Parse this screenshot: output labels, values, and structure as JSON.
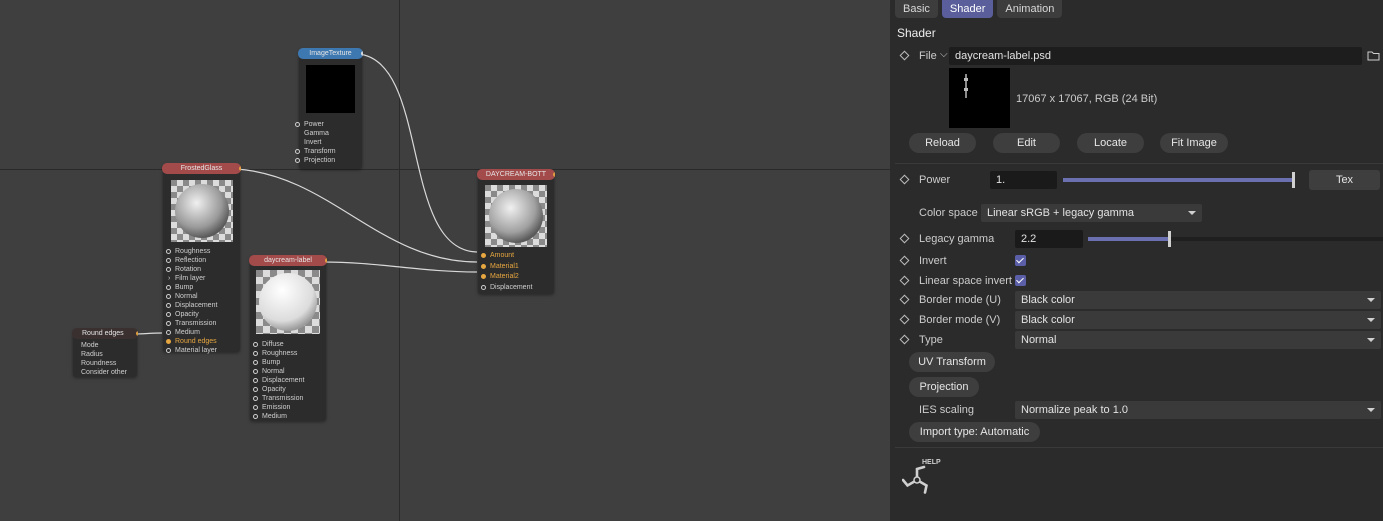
{
  "graph": {
    "nodes": {
      "image_texture": {
        "title": "ImageTexture",
        "pins": [
          "Power",
          "Gamma",
          "Invert",
          "Transform",
          "Projection"
        ]
      },
      "frosted_glass": {
        "title": "FrostedGlass",
        "pins": [
          "Roughness",
          "Reflection",
          "Rotation",
          "Film layer",
          "Bump",
          "Normal",
          "Displacement",
          "Opacity",
          "Transmission",
          "Medium",
          "Round edges",
          "Material layer"
        ]
      },
      "daycream_label": {
        "title": "daycream-label",
        "pins": [
          "Diffuse",
          "Roughness",
          "Bump",
          "Normal",
          "Displacement",
          "Opacity",
          "Transmission",
          "Emission",
          "Medium"
        ]
      },
      "round_edges": {
        "title": "Round edges",
        "pins": [
          "Mode",
          "Radius",
          "Roundness",
          "Consider other"
        ]
      },
      "mix": {
        "title": "DAYCREAM-BOTT",
        "pins": [
          "Amount",
          "Material1",
          "Material2",
          "Displacement"
        ]
      }
    }
  },
  "panel": {
    "tabs": [
      "Basic",
      "Shader",
      "Animation"
    ],
    "active_tab": "Shader",
    "section_title": "Shader",
    "file": {
      "label": "File",
      "value": "daycream-label.psd"
    },
    "image_info": "17067 x 17067, RGB (24 Bit)",
    "buttons": {
      "reload": "Reload",
      "edit": "Edit",
      "locate": "Locate",
      "fit": "Fit Image"
    },
    "power": {
      "label": "Power",
      "value": "1.",
      "level": 1.0,
      "tex_label": "Tex"
    },
    "color_space": {
      "label": "Color space",
      "value": "Linear sRGB + legacy gamma"
    },
    "legacy_gamma": {
      "label": "Legacy gamma",
      "value": "2.2",
      "level": 0.27
    },
    "invert": {
      "label": "Invert",
      "checked": true
    },
    "linear_invert": {
      "label": "Linear space invert",
      "checked": true
    },
    "border_u": {
      "label": "Border mode (U)",
      "value": "Black color"
    },
    "border_v": {
      "label": "Border mode (V)",
      "value": "Black color"
    },
    "type": {
      "label": "Type",
      "value": "Normal"
    },
    "uv_transform": "UV Transform",
    "projection": "Projection",
    "ies": {
      "label": "IES scaling",
      "value": "Normalize peak to 1.0"
    },
    "import_type": "Import type: Automatic",
    "help_label": "HELP"
  }
}
